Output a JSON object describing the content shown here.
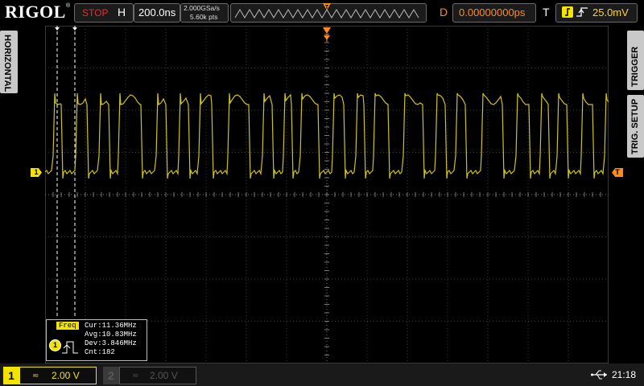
{
  "header": {
    "brand": "RIGOL",
    "run_state": "STOP",
    "h_label": "H",
    "timebase": "200.0ns",
    "sample_rate": "2.000GSa/s",
    "memory_depth": "5.60k pts",
    "d_label": "D",
    "trigger_delay": "0.00000000ps",
    "t_label": "T",
    "trigger_level": "25.0mV",
    "trigger_source_icon": "ch1-source-icon",
    "trigger_edge_icon": "rising-edge-icon"
  },
  "side_tabs": {
    "left": "HORIZONTAL",
    "right_top": "TRIGGER",
    "right_bottom": "TRIG. SETUP"
  },
  "markers": {
    "channel1": "1",
    "trigger": "T"
  },
  "measurement": {
    "title": "Freq",
    "channel": "1",
    "lines": [
      "Cur:11.36MHz",
      "Avg:10.83MHz",
      "Dev:3.846MHz",
      "Cnt:182"
    ]
  },
  "footer": {
    "ch1": {
      "number": "1",
      "coupling": "≂",
      "scale": "2.00 V",
      "enabled": true
    },
    "ch2": {
      "number": "2",
      "coupling": "≂",
      "scale": "2.00 V",
      "enabled": false
    },
    "usb_icon": "usb-icon",
    "time": "21:18"
  },
  "colors": {
    "ch1": "#f2e300",
    "trigger": "#ff8c1a",
    "stop": "#e03030"
  }
}
